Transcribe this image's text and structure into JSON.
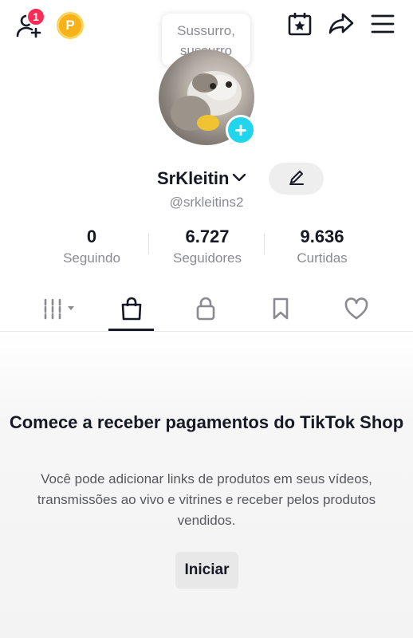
{
  "header": {
    "notification_count": "1",
    "coin_label": "P",
    "tooltip_lines": [
      "Sussurro,",
      "sussurro"
    ],
    "icons": [
      "add-friend-icon",
      "coin-icon",
      "calendar-star-icon",
      "share-icon",
      "menu-icon"
    ]
  },
  "profile": {
    "username": "SrKleitin",
    "handle": "@srkleitins2",
    "avatar_plus": "+",
    "stats": [
      {
        "value": "0",
        "label": "Seguindo"
      },
      {
        "value": "6.727",
        "label": "Seguidores"
      },
      {
        "value": "9.636",
        "label": "Curtidas"
      }
    ]
  },
  "tabs": {
    "items": [
      "videos-grid-icon",
      "shop-bag-icon",
      "private-lock-icon",
      "bookmark-icon",
      "liked-heart-icon"
    ],
    "active": "shop-bag-icon"
  },
  "shop": {
    "title": "Comece a receber pagamentos do TikTok Shop",
    "description": "Você pode adicionar links de produtos em seus vídeos, transmissões ao vivo e vitrines e receber pelos produtos vendidos.",
    "button_label": "Iniciar"
  },
  "colors": {
    "badge": "#fe2c55",
    "coin": "#f7b21a",
    "avatar_plus": "#20d5ec",
    "text_primary": "#161823",
    "text_secondary": "#8a8b91"
  }
}
